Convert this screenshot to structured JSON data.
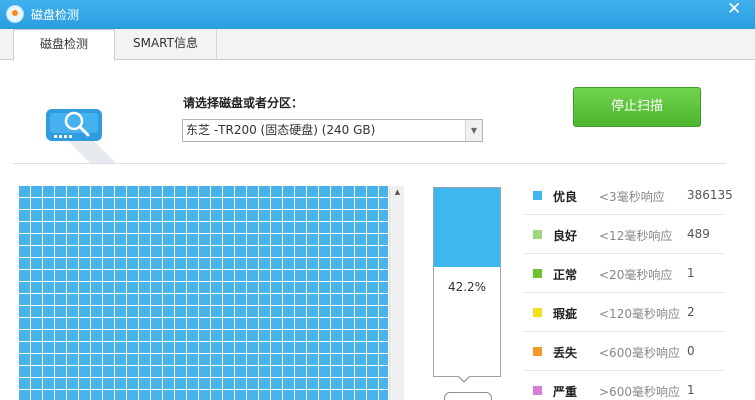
{
  "window": {
    "title": "磁盘检测",
    "accent": "#2aa0e0"
  },
  "tabs": [
    {
      "label": "磁盘检测",
      "active": true
    },
    {
      "label": "SMART信息",
      "active": false
    }
  ],
  "disk_select": {
    "label": "请选择磁盘或者分区：",
    "value": "东芝 -TR200 (固态硬盘)  (240 GB)"
  },
  "actions": {
    "stop_label": "停止扫描",
    "stop_color": "#56bf35"
  },
  "progress": {
    "percent": 42.2,
    "label": "42.2%",
    "fill_color": "#3fb7ee"
  },
  "legend": [
    {
      "name": "优良",
      "desc": "<3毫秒响应",
      "count": "386135",
      "color": "#3fb7ee"
    },
    {
      "name": "良好",
      "desc": "<12毫秒响应",
      "count": "489",
      "color": "#9bd97c"
    },
    {
      "name": "正常",
      "desc": "<20毫秒响应",
      "count": "1",
      "color": "#6fc12e"
    },
    {
      "name": "瑕疵",
      "desc": "<120毫秒响应",
      "count": "2",
      "color": "#f2e01c"
    },
    {
      "name": "丢失",
      "desc": "<600毫秒响应",
      "count": "0",
      "color": "#f39a2c"
    },
    {
      "name": "严重",
      "desc": ">600毫秒响应",
      "count": "1",
      "color": "#d57ed8"
    }
  ],
  "block_map": {
    "color": "#47b3ea"
  }
}
